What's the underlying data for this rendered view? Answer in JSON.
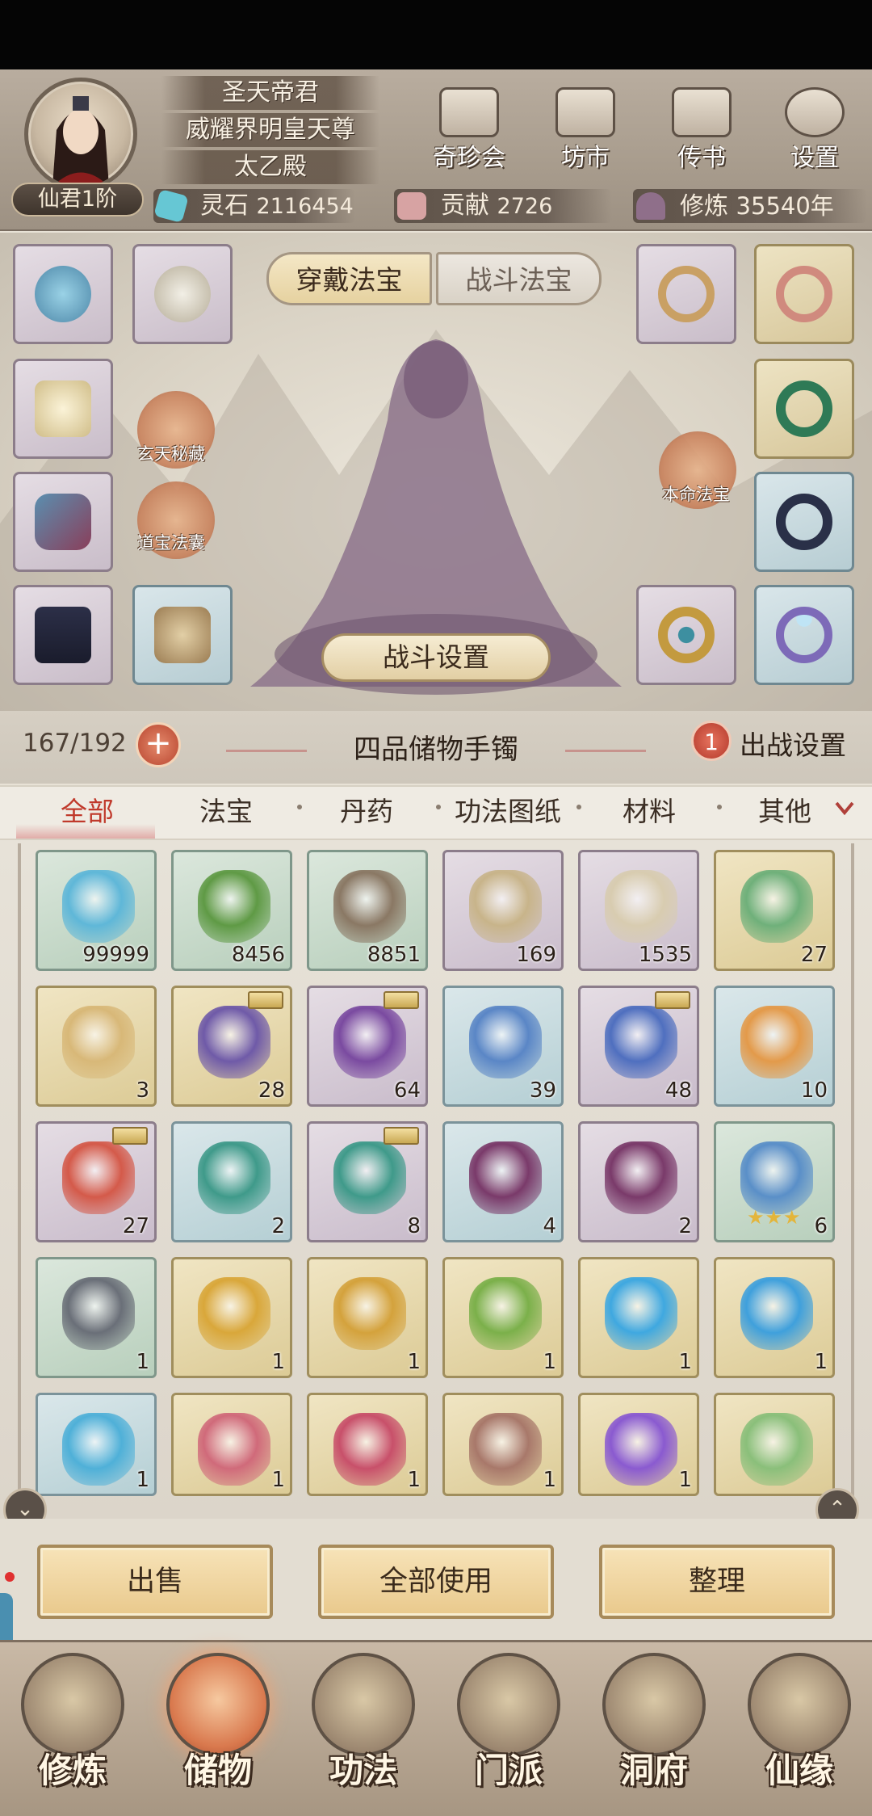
{
  "player": {
    "titles": [
      "圣天帝君",
      "威耀界明皇天尊",
      "太乙殿"
    ],
    "rank": "仙君1阶"
  },
  "top_buttons": [
    {
      "label": "奇珍会",
      "icon": "pavilion-icon"
    },
    {
      "label": "坊市",
      "icon": "market-icon"
    },
    {
      "label": "传书",
      "icon": "scroll-icon"
    },
    {
      "label": "设置",
      "icon": "gear-icon"
    }
  ],
  "resources": {
    "spirit_stone_label": "灵石",
    "spirit_stone_value": "2116454",
    "contribution_label": "贡献",
    "contribution_value": "2726",
    "cultivation_label": "修炼",
    "cultivation_value": "35540年"
  },
  "equip_tabs": {
    "wear": "穿戴法宝",
    "battle": "战斗法宝"
  },
  "side_buttons": {
    "mystic_hoard": "玄天秘藏",
    "treasure_bag": "道宝法囊",
    "natal_treasure": "本命法宝"
  },
  "battle_settings_label": "战斗设置",
  "bag": {
    "capacity": "167/192",
    "plus": "+",
    "title": "四品储物手镯",
    "deploy_count": "1",
    "deploy_label": "出战设置"
  },
  "categories": [
    "全部",
    "法宝",
    "丹药",
    "功法图纸",
    "材料",
    "其他"
  ],
  "items": [
    {
      "count": "99999",
      "rarity": "green",
      "icon": "crystal-icon",
      "color": "#5fb7d8",
      "tag": false
    },
    {
      "count": "8456",
      "rarity": "green",
      "icon": "herb-icon",
      "color": "#5f9a45",
      "tag": false
    },
    {
      "count": "8851",
      "rarity": "green",
      "icon": "ore-icon",
      "color": "#8a7864",
      "tag": false
    },
    {
      "count": "169",
      "rarity": "purple",
      "icon": "scroll-icon",
      "color": "#c8b48a",
      "tag": false
    },
    {
      "count": "1535",
      "rarity": "purple",
      "icon": "formation-scroll-icon",
      "color": "#d8ccb0",
      "tag": false
    },
    {
      "count": "27",
      "rarity": "gold",
      "icon": "jade-sword-icon",
      "color": "#6fb07a",
      "tag": false
    },
    {
      "count": "3",
      "rarity": "gold",
      "icon": "golden-scroll-icon",
      "color": "#d8b878",
      "tag": false
    },
    {
      "count": "28",
      "rarity": "gold",
      "icon": "violet-stone-icon",
      "color": "#6f5aa8",
      "tag": true
    },
    {
      "count": "64",
      "rarity": "purple",
      "icon": "purple-flower-icon",
      "color": "#7a4aa0",
      "tag": true
    },
    {
      "count": "39",
      "rarity": "blue",
      "icon": "blue-flower-icon",
      "color": "#5a86c6",
      "tag": false
    },
    {
      "count": "48",
      "rarity": "purple",
      "icon": "blue-flower-icon",
      "color": "#4f6fbf",
      "tag": true
    },
    {
      "count": "10",
      "rarity": "blue",
      "icon": "orange-flower-icon",
      "color": "#e39a4a",
      "tag": false
    },
    {
      "count": "27",
      "rarity": "purple",
      "icon": "red-flower-icon",
      "color": "#d45a4a",
      "tag": true
    },
    {
      "count": "2",
      "rarity": "blue",
      "icon": "teal-flower-icon",
      "color": "#3f9a8a",
      "tag": false
    },
    {
      "count": "8",
      "rarity": "purple",
      "icon": "teal-flower-icon",
      "color": "#3f9a8a",
      "tag": true
    },
    {
      "count": "4",
      "rarity": "blue",
      "icon": "dark-lotus-icon",
      "color": "#7a3a6a",
      "tag": false
    },
    {
      "count": "2",
      "rarity": "purple",
      "icon": "dark-lotus-icon",
      "color": "#7a3a6a",
      "tag": false
    },
    {
      "count": "6",
      "rarity": "green",
      "icon": "banner-icon",
      "color": "#5a8fc8",
      "tag": false,
      "stars": "★★★"
    },
    {
      "count": "1",
      "rarity": "green",
      "icon": "ring-icon",
      "color": "#6a6f78",
      "tag": false
    },
    {
      "count": "1",
      "rarity": "gold",
      "icon": "golden-blade-icon",
      "color": "#d9a73a",
      "tag": false
    },
    {
      "count": "1",
      "rarity": "gold",
      "icon": "golden-bell-icon",
      "color": "#d4a23c",
      "tag": false
    },
    {
      "count": "1",
      "rarity": "gold",
      "icon": "jade-sword-icon",
      "color": "#7bb04a",
      "tag": false
    },
    {
      "count": "1",
      "rarity": "gold",
      "icon": "water-orb-icon",
      "color": "#3fa8e0",
      "tag": false
    },
    {
      "count": "1",
      "rarity": "gold",
      "icon": "water-orb-icon",
      "color": "#3fa0dc",
      "tag": false
    },
    {
      "count": "1",
      "rarity": "blue",
      "icon": "blue-flower-hook-icon",
      "color": "#4fb0d8",
      "tag": false
    },
    {
      "count": "1",
      "rarity": "gold",
      "icon": "whip-icon",
      "color": "#d06a7a",
      "tag": false
    },
    {
      "count": "1",
      "rarity": "gold",
      "icon": "red-flower-hook-icon",
      "color": "#c8506a",
      "tag": false
    },
    {
      "count": "1",
      "rarity": "gold",
      "icon": "bow-icon",
      "color": "#a8786a",
      "tag": false
    },
    {
      "count": "1",
      "rarity": "gold",
      "icon": "purple-orb-icon",
      "color": "#8a5ad0",
      "tag": false
    },
    {
      "count": "",
      "rarity": "gold",
      "icon": "jade-staff-icon",
      "color": "#8abf7a",
      "tag": false
    }
  ],
  "actions": [
    "出售",
    "全部使用",
    "整理"
  ],
  "nav": [
    {
      "label": "修炼",
      "icon": "cultivate-icon",
      "active": false
    },
    {
      "label": "储物",
      "icon": "storage-bag-icon",
      "active": true
    },
    {
      "label": "功法",
      "icon": "technique-icon",
      "active": false
    },
    {
      "label": "门派",
      "icon": "sect-icon",
      "active": false
    },
    {
      "label": "洞府",
      "icon": "cave-icon",
      "active": false
    },
    {
      "label": "仙缘",
      "icon": "fate-icon",
      "active": false
    }
  ],
  "colors": {
    "accent_red": "#c0392b",
    "button_gold": "#e9c98c",
    "header_bg": "#a89c8d"
  }
}
